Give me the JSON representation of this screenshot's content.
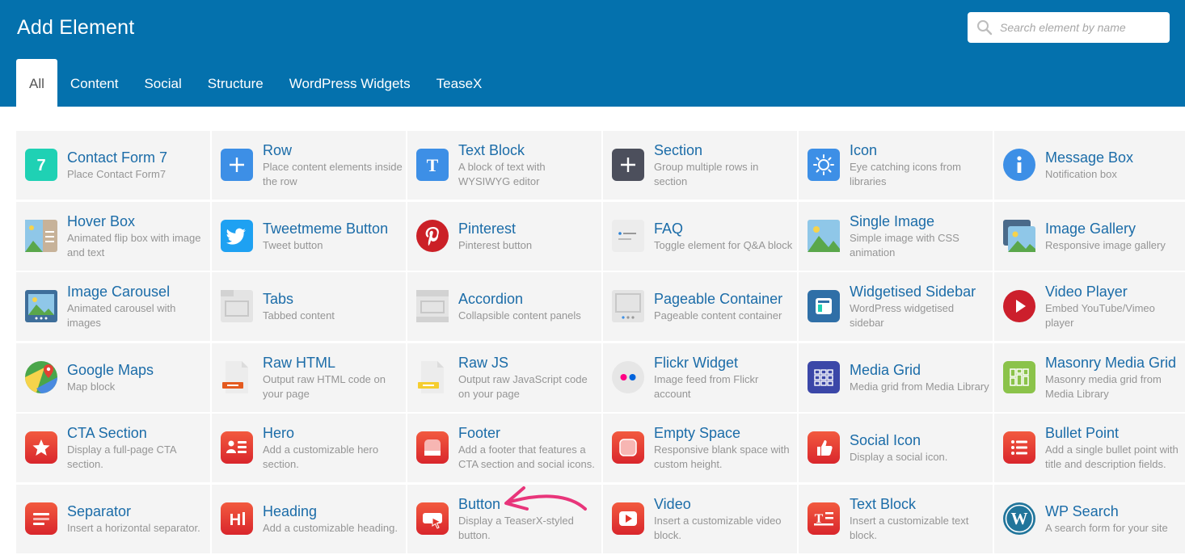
{
  "header": {
    "title": "Add Element",
    "search_placeholder": "Search element by name"
  },
  "tabs": [
    {
      "label": "All",
      "active": true
    },
    {
      "label": "Content",
      "active": false
    },
    {
      "label": "Social",
      "active": false
    },
    {
      "label": "Structure",
      "active": false
    },
    {
      "label": "WordPress Widgets",
      "active": false
    },
    {
      "label": "TeaseX",
      "active": false
    }
  ],
  "elements": [
    {
      "name": "Contact Form 7",
      "desc": "Place Contact Form7",
      "icon": "contact-form-7-icon"
    },
    {
      "name": "Row",
      "desc": "Place content elements inside the row",
      "icon": "plus-icon"
    },
    {
      "name": "Text Block",
      "desc": "A block of text with WYSIWYG editor",
      "icon": "text-t-icon"
    },
    {
      "name": "Section",
      "desc": "Group multiple rows in section",
      "icon": "section-plus-icon"
    },
    {
      "name": "Icon",
      "desc": "Eye catching icons from libraries",
      "icon": "sun-icon"
    },
    {
      "name": "Message Box",
      "desc": "Notification box",
      "icon": "info-icon"
    },
    {
      "name": "Hover Box",
      "desc": "Animated flip box with image and text",
      "icon": "hover-box-icon"
    },
    {
      "name": "Tweetmeme Button",
      "desc": "Tweet button",
      "icon": "twitter-bird-icon"
    },
    {
      "name": "Pinterest",
      "desc": "Pinterest button",
      "icon": "pinterest-icon"
    },
    {
      "name": "FAQ",
      "desc": "Toggle element for Q&A block",
      "icon": "faq-icon"
    },
    {
      "name": "Single Image",
      "desc": "Simple image with CSS animation",
      "icon": "image-icon"
    },
    {
      "name": "Image Gallery",
      "desc": "Responsive image gallery",
      "icon": "image-gallery-icon"
    },
    {
      "name": "Image Carousel",
      "desc": "Animated carousel with images",
      "icon": "image-carousel-icon"
    },
    {
      "name": "Tabs",
      "desc": "Tabbed content",
      "icon": "tabs-icon"
    },
    {
      "name": "Accordion",
      "desc": "Collapsible content panels",
      "icon": "accordion-icon"
    },
    {
      "name": "Pageable Container",
      "desc": "Pageable content container",
      "icon": "pageable-container-icon"
    },
    {
      "name": "Widgetised Sidebar",
      "desc": "WordPress widgetised sidebar",
      "icon": "sidebar-icon"
    },
    {
      "name": "Video Player",
      "desc": "Embed YouTube/Vimeo player",
      "icon": "play-circle-icon"
    },
    {
      "name": "Google Maps",
      "desc": "Map block",
      "icon": "google-maps-icon"
    },
    {
      "name": "Raw HTML",
      "desc": "Output raw HTML code on your page",
      "icon": "raw-html-icon"
    },
    {
      "name": "Raw JS",
      "desc": "Output raw JavaScript code on your page",
      "icon": "raw-js-icon"
    },
    {
      "name": "Flickr Widget",
      "desc": "Image feed from Flickr account",
      "icon": "flickr-icon"
    },
    {
      "name": "Media Grid",
      "desc": "Media grid from Media Library",
      "icon": "media-grid-icon"
    },
    {
      "name": "Masonry Media Grid",
      "desc": "Masonry media grid from Media Library",
      "icon": "masonry-grid-icon"
    },
    {
      "name": "CTA Section",
      "desc": "Display a full-page CTA section.",
      "icon": "star-icon"
    },
    {
      "name": "Hero",
      "desc": "Add a customizable hero section.",
      "icon": "hero-icon"
    },
    {
      "name": "Footer",
      "desc": "Add a footer that features a CTA section and social icons.",
      "icon": "footer-icon"
    },
    {
      "name": "Empty Space",
      "desc": "Responsive blank space with custom height.",
      "icon": "empty-space-icon"
    },
    {
      "name": "Social Icon",
      "desc": "Display a social icon.",
      "icon": "thumbs-up-icon"
    },
    {
      "name": "Bullet Point",
      "desc": "Add a single bullet point with title and description fields.",
      "icon": "bullet-list-icon"
    },
    {
      "name": "Separator",
      "desc": "Insert a horizontal separator.",
      "icon": "separator-icon"
    },
    {
      "name": "Heading",
      "desc": "Add a customizable heading.",
      "icon": "heading-icon"
    },
    {
      "name": "Button",
      "desc": "Display a TeaserX-styled button.",
      "icon": "button-cursor-icon"
    },
    {
      "name": "Video",
      "desc": "Insert a customizable video block.",
      "icon": "video-icon"
    },
    {
      "name": "Text Block",
      "desc": "Insert a customizable text block.",
      "icon": "text-block-icon"
    },
    {
      "name": "WP Search",
      "desc": "A search form for your site",
      "icon": "wordpress-icon"
    }
  ],
  "colors": {
    "header_bg": "#0471ad",
    "title_link": "#1b6ca8",
    "cell_bg": "#f4f4f4",
    "annotation_arrow": "#e8357a"
  }
}
